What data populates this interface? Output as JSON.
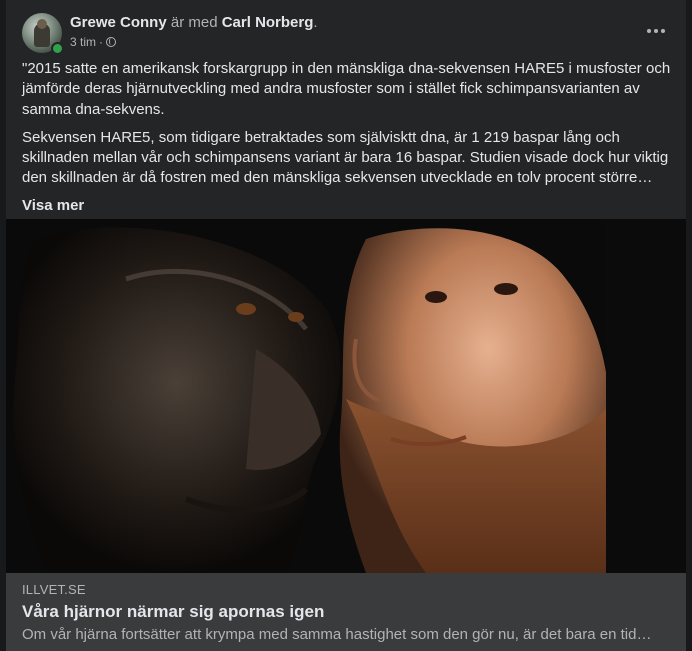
{
  "post": {
    "author": "Grewe Conny",
    "with_text": "är med",
    "tagged": "Carl Norberg",
    "period": ".",
    "time": "3 tim",
    "separator": "·",
    "privacy_icon": "globe-icon",
    "more_icon": "more-options-icon",
    "paragraph1": "\"2015 satte en amerikansk forskargrupp in den mänskliga dna-sekvensen HARE5 i musfoster och jämförde deras hjärnutveckling med andra musfoster som i stället fick schimpansvarianten av samma dna-sekvens.",
    "paragraph2": "Sekvensen HARE5, som tidigare betraktades som självisktt dna, är 1 219 baspar lång och skillnaden mellan vår och schimpansens variant är bara 16 baspar. Studien visade dock hur viktig den skillnaden är då fostren med den mänskliga sekvensen utvecklade en tolv procent större hjärna.",
    "see_more": "Visa mer"
  },
  "link_preview": {
    "domain": "ILLVET.SE",
    "title": "Våra hjärnor närmar sig apornas igen",
    "description": "Om vår hjärna fortsätter att krympa med samma hastighet som den gör nu, är det bara en tid…"
  },
  "colors": {
    "card_bg": "#242526",
    "preview_bg": "#3a3b3c",
    "online": "#31a24c"
  }
}
